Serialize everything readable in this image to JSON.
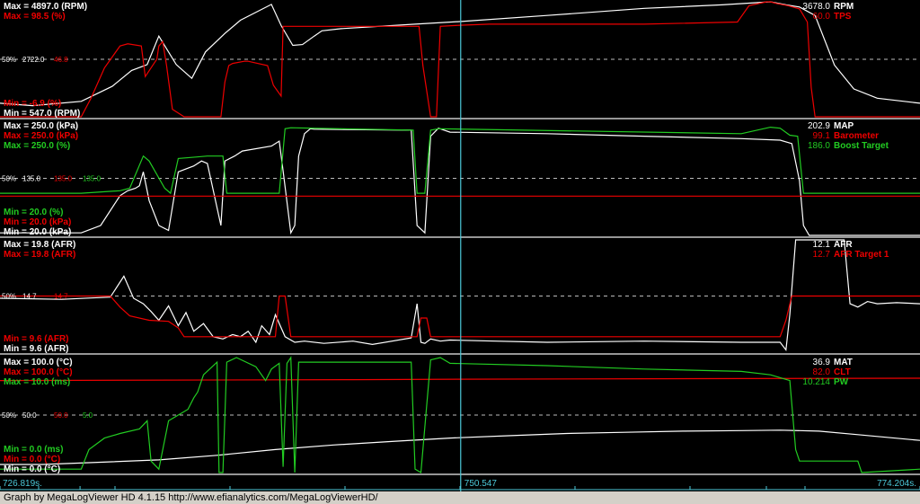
{
  "footer": "Graph by MegaLogViewer HD 4.1.15 http://www.efianalytics.com/MegaLogViewerHD/",
  "time_axis": {
    "start": "726.819s.",
    "cursor": "750.547",
    "end": "774.204s."
  },
  "colors": {
    "white": "#ffffff",
    "red": "#ee0000",
    "green": "#22cc22",
    "yellow": "#cccc00",
    "cursor": "#4cc8d8",
    "divider": "#c8c8c8"
  },
  "chart_data": [
    {
      "type": "line",
      "panel": "rpm_tps",
      "x_range": [
        726.819,
        774.204
      ],
      "cursor_x": 750.547,
      "legend_left": [
        {
          "text": "Max = 4897.0 (RPM)",
          "color": "white"
        },
        {
          "text": "Max = 98.5 (%)",
          "color": "red"
        }
      ],
      "legend_left_bottom": [
        {
          "text": "Min = -6.9 (%)",
          "color": "red"
        },
        {
          "text": "Min = 547.0 (RPM)",
          "color": "white"
        }
      ],
      "legend_right": [
        {
          "value": "3678.0",
          "label": "RPM",
          "color": "white"
        },
        {
          "value": "60.0",
          "label": "TPS",
          "color": "red"
        }
      ],
      "mid_labels": [
        {
          "text": "50%",
          "color": "white"
        },
        {
          "text": "2722.0",
          "color": "white"
        },
        {
          "text": "46.8",
          "color": "red"
        }
      ],
      "series": [
        {
          "name": "RPM",
          "color": "white",
          "ylim": [
            547.0,
            4897.0
          ],
          "x": [
            726.819,
            728.5,
            731.0,
            732.6,
            733.6,
            734.4,
            735.0,
            735.9,
            736.7,
            737.4,
            738.4,
            739.2,
            740.8,
            741.3,
            741.9,
            742.4,
            743.0,
            743.4,
            744.4,
            748.2,
            750.5,
            755.0,
            760.0,
            764.0,
            766.5,
            767.3,
            768.0,
            768.8,
            769.8,
            770.8,
            772.0,
            774.204
          ],
          "y": [
            1060,
            970,
            1130,
            1700,
            2300,
            2520,
            3600,
            2520,
            2000,
            3000,
            3700,
            4200,
            4800,
            4000,
            3250,
            3280,
            3600,
            3800,
            3880,
            4050,
            4150,
            4380,
            4650,
            4780,
            4897,
            4780,
            4700,
            4380,
            2500,
            1600,
            1250,
            1060
          ]
        },
        {
          "name": "TPS",
          "color": "red",
          "ylim": [
            -6.9,
            98.5
          ],
          "x": [
            726.819,
            728.0,
            730.0,
            731.0,
            731.5,
            732.2,
            733.0,
            733.4,
            734.1,
            734.3,
            734.9,
            735.0,
            735.2,
            735.4,
            735.7,
            736.3,
            737.0,
            738.2,
            738.4,
            738.6,
            738.8,
            739.4,
            739.6,
            740.6,
            740.9,
            741.3,
            741.4,
            741.8,
            748.4,
            748.6,
            749.0,
            749.3,
            749.5,
            750.5,
            752.0,
            760.0,
            764.8,
            765.4,
            766.3,
            766.5,
            766.8,
            767.4,
            768.0,
            768.4,
            768.6,
            768.8,
            770.0,
            774.204
          ],
          "y": [
            -6.9,
            -6.9,
            -6.9,
            -6.9,
            10,
            38,
            58,
            60,
            58,
            30,
            46,
            58,
            62,
            40,
            0,
            -6.9,
            -6.9,
            -6.9,
            25,
            40,
            42,
            44,
            44,
            40,
            22,
            12,
            76,
            76,
            76,
            40,
            -6.9,
            -6.9,
            76,
            77,
            78,
            78,
            80,
            95,
            98.5,
            98.5,
            97,
            95,
            92,
            80,
            20,
            -6.9,
            -6.9,
            -6.9
          ]
        }
      ]
    },
    {
      "type": "line",
      "panel": "map_baro_boost",
      "x_range": [
        726.819,
        774.204
      ],
      "cursor_x": 750.547,
      "legend_left": [
        {
          "text": "Max = 250.0 (kPa)",
          "color": "white"
        },
        {
          "text": "Max = 250.0 (kPa)",
          "color": "red"
        },
        {
          "text": "Max = 250.0 (%)",
          "color": "green"
        }
      ],
      "legend_left_bottom": [
        {
          "text": "Min = 20.0 (%)",
          "color": "green"
        },
        {
          "text": "Min = 20.0 (kPa)",
          "color": "red"
        },
        {
          "text": "Min = 20.0 (kPa)",
          "color": "white"
        }
      ],
      "legend_right": [
        {
          "value": "202.9",
          "label": "MAP",
          "color": "white"
        },
        {
          "value": "99.1",
          "label": "Barometer",
          "color": "red"
        },
        {
          "value": "186.0",
          "label": "Boost Target",
          "color": "green"
        }
      ],
      "mid_labels": [
        {
          "text": "50%",
          "color": "white"
        },
        {
          "text": "135.0",
          "color": "white"
        },
        {
          "text": "135.0",
          "color": "red"
        },
        {
          "text": "135.0",
          "color": "green"
        }
      ],
      "series": [
        {
          "name": "MAP",
          "color": "white",
          "ylim": [
            20.0,
            250.0
          ],
          "x": [
            726.819,
            731.0,
            732.0,
            733.0,
            733.4,
            733.8,
            734.0,
            734.2,
            734.5,
            735.0,
            735.5,
            736.0,
            736.8,
            737.2,
            737.5,
            738.2,
            738.4,
            738.9,
            739.3,
            740.8,
            741.2,
            741.4,
            741.8,
            742.0,
            742.2,
            742.5,
            742.8,
            743.0,
            748.0,
            748.3,
            748.7,
            749.0,
            749.4,
            750.0,
            755.0,
            760.0,
            765.0,
            767.0,
            767.6,
            768.0,
            768.2,
            768.5,
            774.204
          ],
          "y": [
            25,
            25,
            40,
            100,
            110,
            115,
            120,
            148,
            90,
            40,
            30,
            148,
            160,
            170,
            165,
            40,
            170,
            180,
            190,
            200,
            210,
            150,
            25,
            40,
            180,
            225,
            235,
            234,
            232,
            40,
            25,
            220,
            236,
            228,
            225,
            220,
            215,
            212,
            205,
            130,
            40,
            20,
            20
          ]
        },
        {
          "name": "Barometer",
          "color": "red",
          "ylim": [
            20.0,
            250.0
          ],
          "x": [
            726.819,
            774.204
          ],
          "y": [
            99.1,
            99.1
          ]
        },
        {
          "name": "Boost Target",
          "color": "green",
          "ylim": [
            20.0,
            250.0
          ],
          "x": [
            726.819,
            731.0,
            733.0,
            733.5,
            734.2,
            734.5,
            735.3,
            735.6,
            736.0,
            736.9,
            737.5,
            738.3,
            738.5,
            740.8,
            741.2,
            741.5,
            741.8,
            748.1,
            748.3,
            748.7,
            749.0,
            749.4,
            765.0,
            766.5,
            767.0,
            767.5,
            767.9,
            768.2,
            774.204
          ],
          "y": [
            105,
            105,
            110,
            115,
            180,
            170,
            115,
            105,
            175,
            178,
            180,
            180,
            105,
            105,
            105,
            235,
            237,
            232,
            105,
            105,
            232,
            235,
            225,
            238,
            236,
            222,
            220,
            105,
            105
          ]
        }
      ]
    },
    {
      "type": "line",
      "panel": "afr",
      "x_range": [
        726.819,
        774.204
      ],
      "cursor_x": 750.547,
      "legend_left": [
        {
          "text": "Max = 19.8 (AFR)",
          "color": "white"
        },
        {
          "text": "Max = 19.8 (AFR)",
          "color": "red"
        }
      ],
      "legend_left_bottom": [
        {
          "text": "Min = 9.6 (AFR)",
          "color": "red"
        },
        {
          "text": "Min = 9.6 (AFR)",
          "color": "white"
        }
      ],
      "legend_right": [
        {
          "value": "12.1",
          "label": "AFR",
          "color": "white"
        },
        {
          "value": "12.7",
          "label": "AFR Target 1",
          "color": "red"
        }
      ],
      "mid_labels": [
        {
          "text": "50%",
          "color": "white"
        },
        {
          "text": "14.7",
          "color": "white"
        },
        {
          "text": "14.7",
          "color": "red"
        }
      ],
      "series": [
        {
          "name": "AFR",
          "color": "white",
          "ylim": [
            9.6,
            19.8
          ],
          "x": [
            726.819,
            730.0,
            732.5,
            733.2,
            733.7,
            734.2,
            734.6,
            735.0,
            735.5,
            736.0,
            736.4,
            736.8,
            737.3,
            737.8,
            738.3,
            738.8,
            739.2,
            739.6,
            740.0,
            740.3,
            740.7,
            741.0,
            741.5,
            742.0,
            742.5,
            743.5,
            745.0,
            746.0,
            748.0,
            748.3,
            748.5,
            748.7,
            749.0,
            749.5,
            750.0,
            755.0,
            760.0,
            765.0,
            767.0,
            767.3,
            767.5,
            767.8,
            768.0,
            768.3,
            768.6,
            769.5,
            770.3,
            770.6,
            771.0,
            771.5,
            772.0,
            773.0,
            774.204
          ],
          "y": [
            14.5,
            14.4,
            14.6,
            16.5,
            14.5,
            14.0,
            13.3,
            12.5,
            13.8,
            12.0,
            13.2,
            11.5,
            12.2,
            11.0,
            10.8,
            11.2,
            11.0,
            11.5,
            10.5,
            12.0,
            11.2,
            13.0,
            11.0,
            10.5,
            10.6,
            10.4,
            10.6,
            10.3,
            10.9,
            14.0,
            10.5,
            10.4,
            10.8,
            10.6,
            10.7,
            10.5,
            10.6,
            10.5,
            10.5,
            9.8,
            13.0,
            19.8,
            19.8,
            19.8,
            19.8,
            19.8,
            19.8,
            14.0,
            13.7,
            14.2,
            14.0,
            14.1,
            14.0
          ]
        },
        {
          "name": "AFR Target 1",
          "color": "red",
          "ylim": [
            9.6,
            19.8
          ],
          "x": [
            726.819,
            732.5,
            733.0,
            733.5,
            734.5,
            735.5,
            736.0,
            736.3,
            738.4,
            741.0,
            741.2,
            741.5,
            741.8,
            742.0,
            748.3,
            748.5,
            748.8,
            749.0,
            767.0,
            767.3,
            767.6,
            774.204
          ],
          "y": [
            14.7,
            14.7,
            13.7,
            12.9,
            12.5,
            12.4,
            11.8,
            11.0,
            11.0,
            11.0,
            14.7,
            14.7,
            11.0,
            11.0,
            11.0,
            12.7,
            12.7,
            11.0,
            11.0,
            12.5,
            14.7,
            14.7
          ]
        }
      ]
    },
    {
      "type": "line",
      "panel": "mat_clt_pw",
      "x_range": [
        726.819,
        774.204
      ],
      "cursor_x": 750.547,
      "legend_left": [
        {
          "text": "Max = 100.0 (°C)",
          "color": "white"
        },
        {
          "text": "Max = 100.0 (°C)",
          "color": "red"
        },
        {
          "text": "Max = 10.0 (ms)",
          "color": "green"
        }
      ],
      "legend_left_bottom": [
        {
          "text": "Min = 0.0 (ms)",
          "color": "green"
        },
        {
          "text": "Min = 0.0 (°C)",
          "color": "red"
        },
        {
          "text": "Min = 0.0 (°C)",
          "color": "white"
        }
      ],
      "legend_right": [
        {
          "value": "36.9",
          "label": "MAT",
          "color": "white"
        },
        {
          "value": "82.0",
          "label": "CLT",
          "color": "red"
        },
        {
          "value": "10.214",
          "label": "PW",
          "color": "green"
        }
      ],
      "mid_labels": [
        {
          "text": "50%",
          "color": "white"
        },
        {
          "text": "50.0",
          "color": "white"
        },
        {
          "text": "50.0",
          "color": "red"
        },
        {
          "text": "5.0",
          "color": "green"
        }
      ],
      "series": [
        {
          "name": "MAT",
          "color": "white",
          "ylim": [
            0.0,
            100.0
          ],
          "x": [
            726.819,
            729.0,
            732.0,
            735.0,
            738.0,
            741.0,
            744.0,
            747.0,
            750.0,
            753.0,
            756.0,
            759.0,
            762.0,
            765.0,
            767.0,
            769.0,
            771.0,
            774.204
          ],
          "y": [
            7,
            7,
            9,
            11,
            15,
            20,
            24,
            27,
            30,
            32,
            34,
            35,
            36,
            36.5,
            36.9,
            36,
            33,
            28
          ]
        },
        {
          "name": "CLT",
          "color": "red",
          "ylim": [
            0.0,
            100.0
          ],
          "x": [
            726.819,
            745.0,
            750.5,
            760.0,
            774.204
          ],
          "y": [
            80,
            80.8,
            81.2,
            81.6,
            82.0
          ]
        },
        {
          "name": "PW",
          "color": "green",
          "ylim": [
            0.0,
            10.0
          ],
          "x": [
            726.819,
            731.0,
            731.4,
            732.2,
            733.0,
            734.0,
            734.4,
            734.6,
            735.0,
            735.5,
            736.0,
            736.5,
            736.8,
            737.0,
            737.3,
            738.0,
            738.1,
            738.3,
            738.5,
            739.0,
            740.0,
            740.5,
            740.8,
            741.2,
            741.4,
            741.6,
            741.8,
            742.0,
            742.2,
            748.0,
            748.2,
            748.5,
            749.0,
            749.5,
            750.0,
            755.0,
            760.0,
            765.0,
            766.5,
            767.5,
            767.8,
            768.0,
            770.0,
            771.0,
            771.2,
            774.204
          ],
          "y": [
            0.3,
            0.3,
            2.0,
            3.0,
            3.4,
            3.8,
            4.5,
            1.0,
            0.3,
            4.5,
            5.0,
            5.5,
            6.5,
            7.0,
            8.5,
            9.6,
            0.0,
            0.0,
            9.6,
            10.0,
            9.2,
            8.0,
            9.0,
            9.5,
            0.5,
            9.5,
            10.0,
            0.0,
            9.6,
            9.6,
            0.3,
            0.0,
            9.8,
            10.0,
            9.5,
            9.3,
            9.0,
            8.8,
            8.5,
            8.0,
            2.0,
            1.0,
            1.0,
            1.0,
            0.0,
            0.3
          ]
        }
      ]
    }
  ]
}
